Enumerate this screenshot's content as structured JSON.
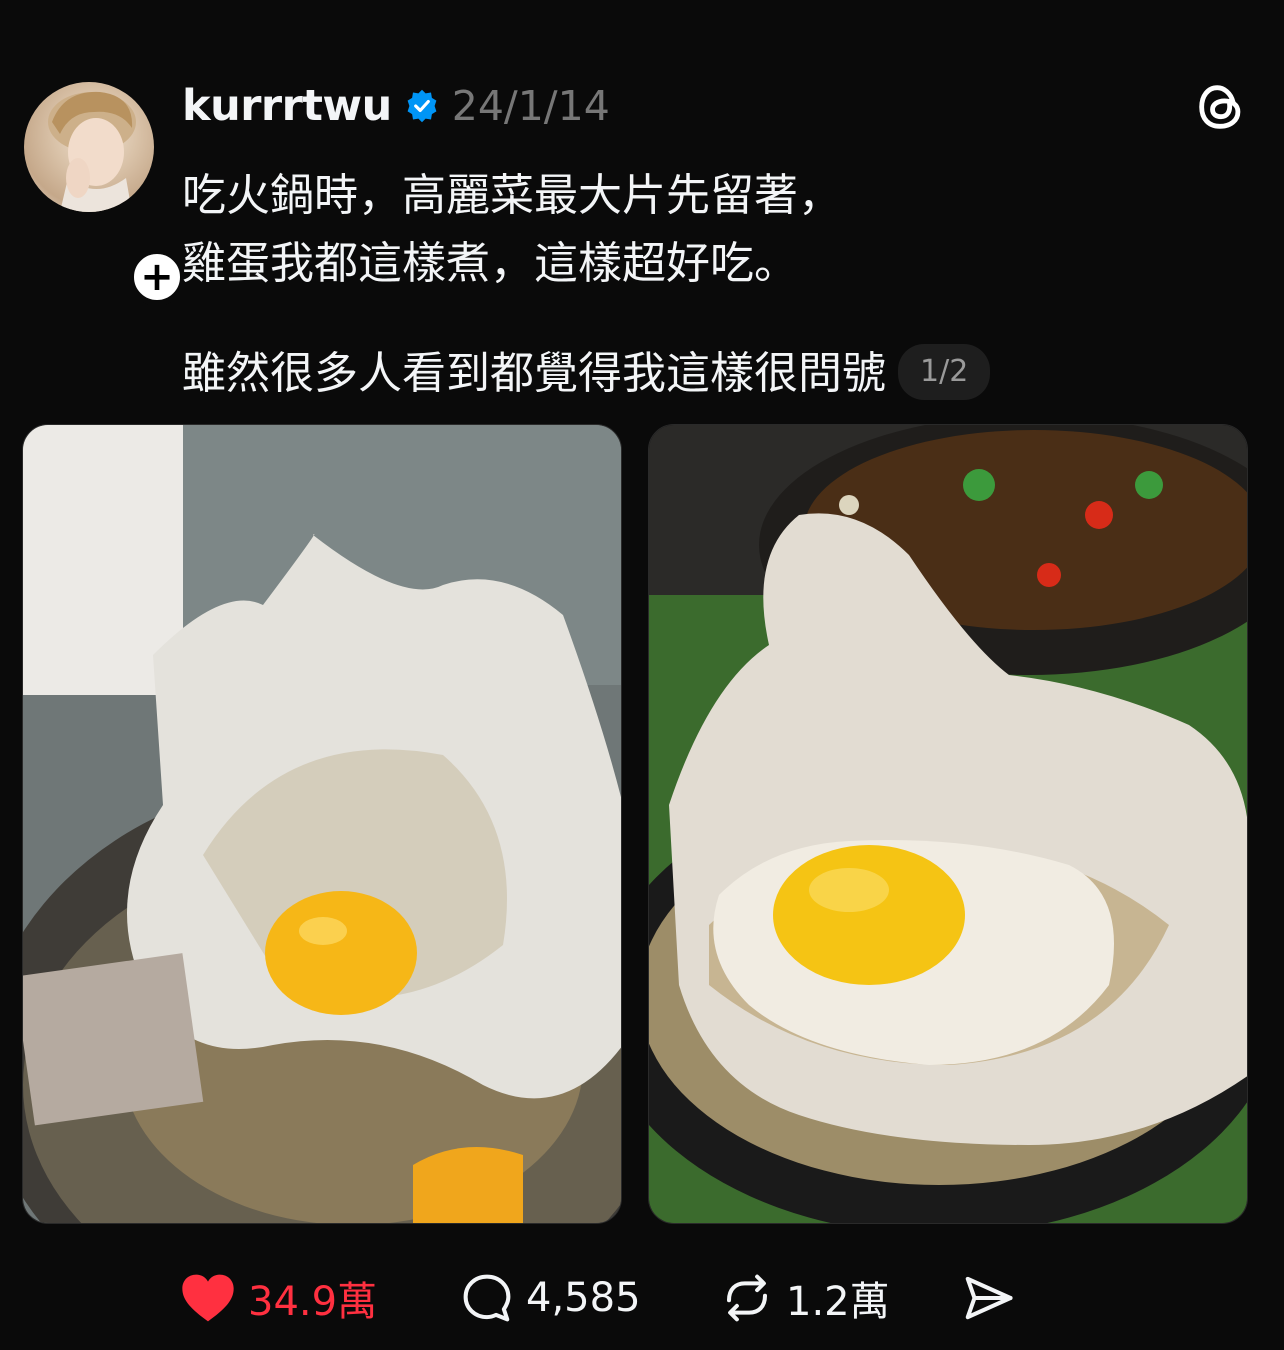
{
  "post": {
    "username": "kurrrtwu",
    "timestamp": "24/1/14",
    "follow_symbol": "+",
    "text_lines": [
      "吃火鍋時，高麗菜最大片先留著，",
      "雞蛋我都這樣煮，這樣超好吃。",
      "雖然很多人看到都覺得我這樣很問號"
    ],
    "page_indicator": "1/2"
  },
  "actions": {
    "likes": "34.9萬",
    "replies": "4,585",
    "reposts": "1.2萬"
  },
  "colors": {
    "background": "#0a0a0a",
    "text": "#f3f5f7",
    "muted": "#777777",
    "like_red": "#ff3040",
    "verified_blue": "#0095f6"
  },
  "icons": {
    "verified": "verified-badge-icon",
    "threads": "threads-logo-icon",
    "like": "heart-icon",
    "reply": "comment-icon",
    "repost": "repost-icon",
    "share": "send-icon"
  }
}
